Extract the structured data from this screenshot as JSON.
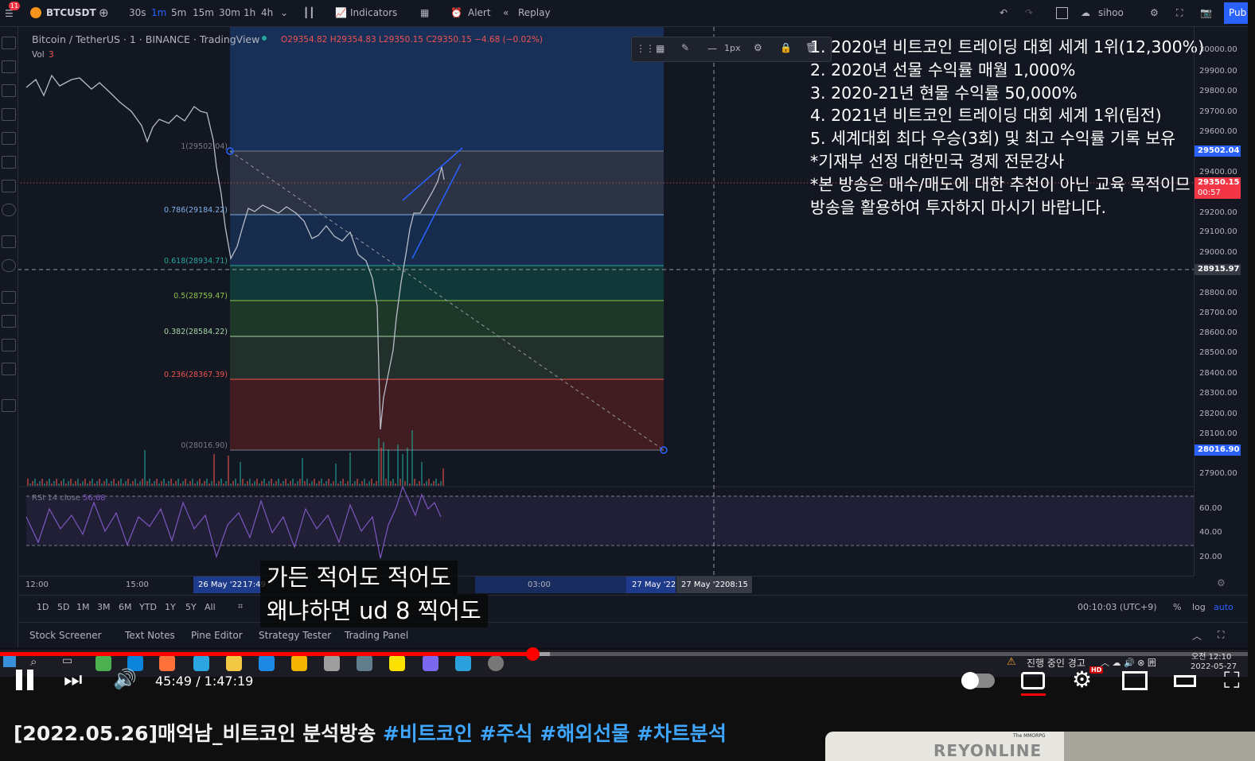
{
  "topbar": {
    "notif_count": "11",
    "symbol": "BTCUSDT",
    "intervals": [
      "30s",
      "1m",
      "5m",
      "15m",
      "30m",
      "1h",
      "4h"
    ],
    "active_interval": "1m",
    "indicators": "Indicators",
    "alert": "Alert",
    "replay": "Replay",
    "user": "sihoo",
    "publish": "Pub"
  },
  "legend": {
    "title": "Bitcoin / TetherUS · 1 · BINANCE · TradingView",
    "ohlc": "O29354.82 H29354.83 L29350.15 C29350.15 −4.68 (−0.02%)",
    "vol_label": "Vol",
    "vol_value": "3",
    "rsi_label": "RSI 14 close",
    "rsi_value": "56.68"
  },
  "drawing_toolbar": {
    "width_label": "1px"
  },
  "fib_levels": [
    {
      "label": "1(29502.04)",
      "color": "#787b86"
    },
    {
      "label": "0.786(29184.22)",
      "color": "#7eb1e8"
    },
    {
      "label": "0.618(28934.71)",
      "color": "#26a69a"
    },
    {
      "label": "0.5(28759.47)",
      "color": "#8bc34a"
    },
    {
      "label": "0.382(28584.22)",
      "color": "#a5d6a7"
    },
    {
      "label": "0.236(28367.39)",
      "color": "#ef5350"
    },
    {
      "label": "0(28016.90)",
      "color": "#787b86"
    }
  ],
  "price_scale": {
    "labels": [
      "30000.00",
      "29900.00",
      "29800.00",
      "29700.00",
      "29600.00",
      "29400.00",
      "29300.00",
      "29200.00",
      "29100.00",
      "29000.00",
      "28800.00",
      "28700.00",
      "28600.00",
      "28500.00",
      "28400.00",
      "28300.00",
      "28200.00",
      "28100.00",
      "27900.00"
    ],
    "tag_top": "29502.04",
    "tag_current": "29350.15",
    "tag_countdown": "00:57",
    "tag_crosshair": "28915.97",
    "tag_bottom": "28016.90",
    "rsi_labels": [
      "60.00",
      "40.00",
      "20.00"
    ]
  },
  "time_axis": {
    "labels": [
      "12:00",
      "15:00",
      "03:00"
    ],
    "hl_start_date": "26 May '22",
    "hl_start_time": "17:49",
    "hl_end_date": "27 May '22",
    "crosshair_date": "27 May '22",
    "crosshair_time": "08:15"
  },
  "range_bar": {
    "ranges": [
      "1D",
      "5D",
      "1M",
      "3M",
      "6M",
      "YTD",
      "1Y",
      "5Y",
      "All"
    ],
    "clock": "00:10:03 (UTC+9)",
    "pct": "%",
    "log": "log",
    "auto": "auto"
  },
  "bottom_tabs": [
    "Stock Screener",
    "Text Notes",
    "Pine Editor",
    "Strategy Tester",
    "Trading Panel"
  ],
  "overlay_lines": [
    "1. 2020년 비트코인 트레이딩 대회 세계 1위(12,300%)",
    "2. 2020년 선물 수익률 매월 1,000%",
    "3. 2020-21년 현물 수익률 50,000%",
    "4. 2021년 비트코인 트레이딩 대회 세계 1위(팀전)",
    "5. 세계대회 최다 우승(3회) 및 최고 수익률 기록 보유",
    "*기재부 선정 대한민국 경제 전문강사",
    "*본 방송은 매수/매도에 대한 추천이 아닌 교육 목적이므",
    " 방송을 활용하여 투자하지 마시기 바랍니다."
  ],
  "subtitles": [
    "가든 적어도 적어도",
    "왜냐하면 ud 8 찍어도"
  ],
  "taskbar": {
    "warning": "진행 중인 경고",
    "time": "오전 12:10",
    "date": "2022-05-27"
  },
  "player": {
    "time": "45:49 / 1:47:19",
    "progress": 0.4268,
    "hd_badge": "HD"
  },
  "video_title": {
    "main": "[2022.05.26]매억남_비트코인 분석방송",
    "tags": [
      "#비트코인",
      "#주식",
      "#해외선물",
      "#차트분석"
    ]
  },
  "ad": {
    "small": "The MMORPG",
    "big": "REYONLINE"
  }
}
